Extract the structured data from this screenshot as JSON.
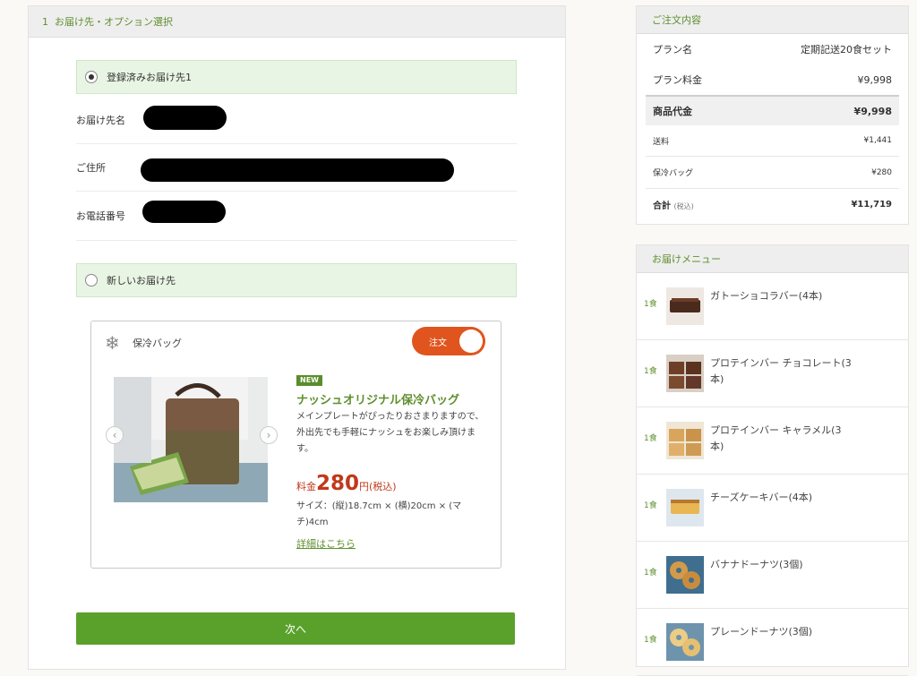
{
  "left": {
    "step_number": "1",
    "section_title": "お届け先・オプション選択",
    "registered_label": "登録済みお届け先1",
    "recipient_label": "お届け先名",
    "address_label": "ご住所",
    "phone_label": "お電話番号",
    "new_address_label": "新しいお届け先",
    "option": {
      "name": "保冷バッグ",
      "toggle_label": "注文",
      "badge": "NEW",
      "title": "ナッシュオリジナル保冷バッグ",
      "description": "メインプレートがぴったりおさまりますので、外出先でも手軽にナッシュをお楽しみ頂けます。",
      "price_label": "料金",
      "price_value": "280",
      "price_unit": "円(税込)",
      "size": "サイズ：(縦)18.7cm × (横)20cm × (マチ)4cm",
      "detail_link": "詳細はこちら"
    },
    "next_button": "次へ"
  },
  "summary": {
    "title": "ご注文内容",
    "plan_label": "プラン名",
    "plan_value": "定期記送20食セット",
    "plan_fee_label": "プラン料金",
    "plan_fee_value": "¥9,998",
    "subtotal_label": "商品代金",
    "subtotal_value": "¥9,998",
    "shipping_label": "送料",
    "shipping_value": "¥1,441",
    "bag_label": "保冷バッグ",
    "bag_value": "¥280",
    "total_label": "合計",
    "total_note": "(税込)",
    "total_value": "¥11,719"
  },
  "menu": {
    "title": "お届けメニュー",
    "items": [
      {
        "qty": "1食",
        "name": "ガトーショコラバー(4本)"
      },
      {
        "qty": "1食",
        "name": "プロテインバー チョコレート(3本)"
      },
      {
        "qty": "1食",
        "name": "プロテインバー キャラメル(3本)"
      },
      {
        "qty": "1食",
        "name": "チーズケーキバー(4本)"
      },
      {
        "qty": "1食",
        "name": "バナナドーナツ(3個)"
      },
      {
        "qty": "1食",
        "name": "プレーンドーナツ(3個)"
      }
    ]
  }
}
